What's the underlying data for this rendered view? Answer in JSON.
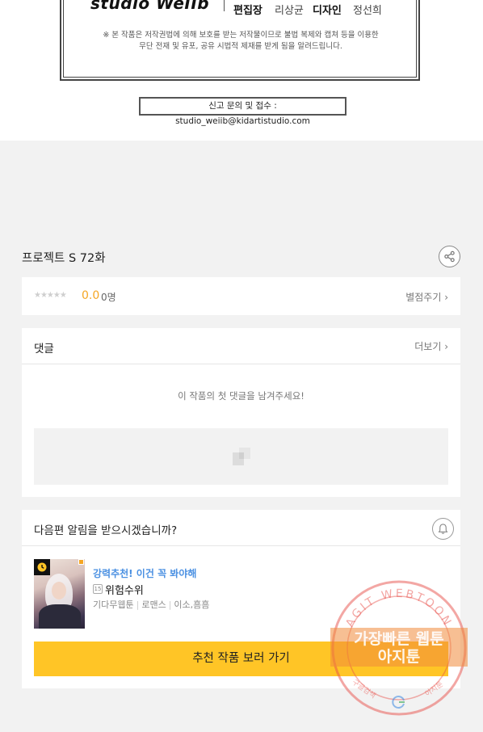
{
  "credit": {
    "studio_name": "studio WeIIb",
    "staff": [
      {
        "role": "편집장",
        "name": "리상균"
      },
      {
        "role": "디자인",
        "name": "정선희"
      }
    ],
    "copyright_line1": "※ 본 작품은 저작권법에 의해 보호를 받는 저작물이므로 불법 복제와 캡쳐 등을 이용한",
    "copyright_line2": "무단 전재 및 유포, 공유 시법적 제재를 받게 됨을 알려드립니다.",
    "report_contact": "신고 문의 및 접수 : studio_weiib@kidartistudio.com"
  },
  "episode": {
    "title": "프로젝트 S 72화"
  },
  "rating": {
    "stars": "★★★★★",
    "value": "0.0",
    "count": "0명",
    "rate_link": "별점주기 ›"
  },
  "comments": {
    "title": "댓글",
    "more_link": "더보기 ›",
    "empty_message": "이 작품의 첫 댓글을 남겨주세요!"
  },
  "notify": {
    "question": "다음편 알림을 받으시겠습니까?"
  },
  "recommendation": {
    "tag": "강력추천! 이건 꼭 봐야해",
    "age_label": "15",
    "name": "위험수위",
    "genres": [
      "기다무웹툰",
      "로맨스",
      "이소,흠흠"
    ],
    "button_label": "추천 작품 보러 가기"
  },
  "watermark": {
    "ring_text": "AGIT WEBTOON",
    "main_line1": "가장빠른 웹툰",
    "main_line2": "아지툰",
    "bottom_left": "구글검색",
    "bottom_right": "아지툰"
  },
  "colors": {
    "accent_yellow": "#ffc526",
    "rating_orange": "#f5a623",
    "tag_blue": "#4a90e2",
    "watermark_red": "#e8504a"
  }
}
